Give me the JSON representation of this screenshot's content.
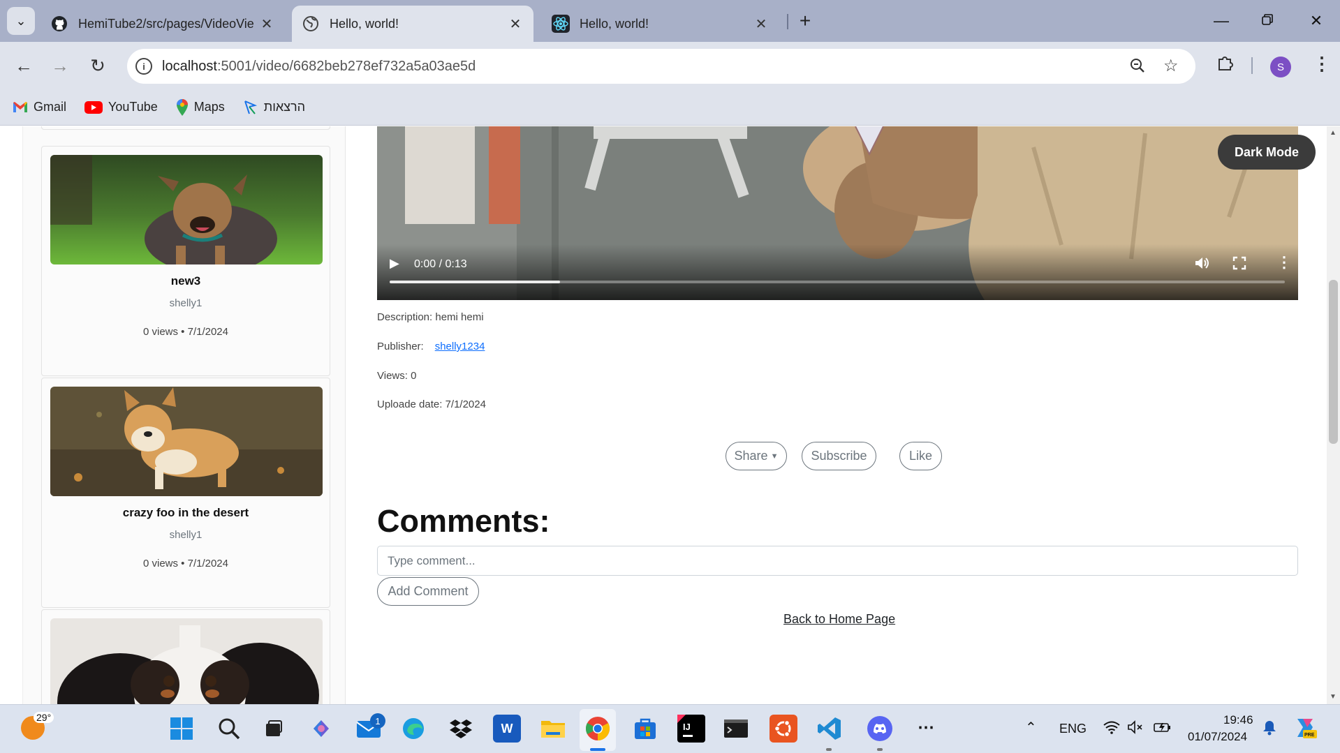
{
  "browser": {
    "tabs": [
      {
        "title": "HemiTube2/src/pages/VideoVie",
        "icon": "github-icon",
        "active": false
      },
      {
        "title": "Hello, world!",
        "icon": "globe-icon",
        "active": true
      },
      {
        "title": "Hello, world!",
        "icon": "react-icon",
        "active": false
      }
    ],
    "url_host": "localhost",
    "url_path": ":5001/video/6682beb278ef732a5a03ae5d",
    "profile_initial": "S",
    "bookmarks": [
      {
        "label": "Gmail",
        "icon": "gmail-icon"
      },
      {
        "label": "YouTube",
        "icon": "youtube-icon"
      },
      {
        "label": "Maps",
        "icon": "maps-icon"
      },
      {
        "label": "הרצאות",
        "icon": "drive-icon"
      }
    ]
  },
  "sidebar": {
    "videos": [
      {
        "title": "new3",
        "publisher": "shelly1",
        "meta": "0 views • 7/1/2024"
      },
      {
        "title": "crazy foo in the desert",
        "publisher": "shelly1",
        "meta": "0 views • 7/1/2024"
      }
    ]
  },
  "player": {
    "time": "0:00 / 0:13",
    "progress_fraction": 0.19
  },
  "dark_mode_label": "Dark Mode",
  "details": {
    "description": "Description: hemi hemi",
    "publisher_label": "Publisher:",
    "publisher_link": "shelly1234",
    "views": "Views: 0",
    "upload_date": "Uploade date: 7/1/2024"
  },
  "actions": {
    "share": "Share",
    "subscribe": "Subscribe",
    "like": "Like"
  },
  "comments": {
    "heading": "Comments:",
    "placeholder": "Type comment...",
    "add_label": "Add Comment"
  },
  "back_link": "Back to Home Page",
  "taskbar": {
    "weather_temp": "29°",
    "mail_badge": "1",
    "language": "ENG",
    "time": "19:46",
    "date": "01/07/2024"
  }
}
